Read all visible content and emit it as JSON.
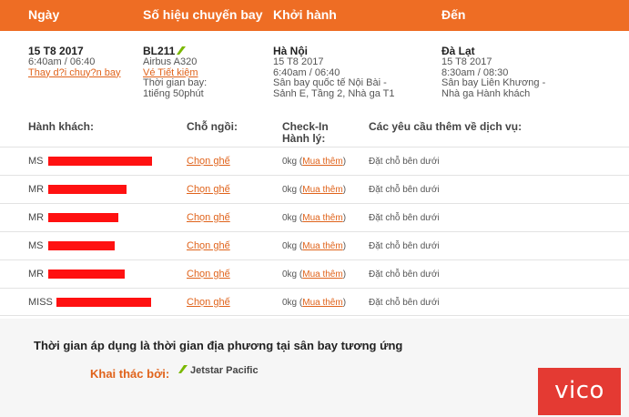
{
  "colors": {
    "accent": "#ee6d24",
    "link": "#e0631b",
    "redaction": "#ff1111",
    "brand": "#e43a33",
    "operator_mark": "#7ab800"
  },
  "header": {
    "date": "Ngày",
    "flight_no": "Số hiệu chuyến bay",
    "departure": "Khởi hành",
    "arrival": "Đến"
  },
  "flight": {
    "date": "15 T8 2017",
    "time": "6:40am / 06:40",
    "change_link": "Thay d?i chuy?n bay",
    "number": "BL211",
    "aircraft": "Airbus A320",
    "fare_link": "Vé Tiết kiệm",
    "duration_label": "Thời gian bay:",
    "duration": "1tiếng 50phút",
    "origin": {
      "city": "Hà Nội",
      "date": "15 T8 2017",
      "time": "6:40am / 06:40",
      "airport": "Sân bay quốc tế Nội Bài -",
      "terminal": "Sảnh E, Tầng 2, Nhà ga T1"
    },
    "destination": {
      "city": "Đà Lạt",
      "date": "15 T8 2017",
      "time": "8:30am / 08:30",
      "airport": "Sân bay Liên Khương -",
      "terminal": "Nhà ga Hành khách"
    }
  },
  "passengers_header": {
    "passenger": "Hành khách:",
    "seat": "Chỗ ngồi:",
    "checkin_line1": "Check-In",
    "checkin_line2": "Hành lý:",
    "extra": "Các yêu cầu thêm về dịch vụ:"
  },
  "passengers": [
    {
      "title": "MS",
      "seat": "Chọn ghế",
      "bag": "0kg (",
      "buy": "Mua thêm",
      "bag_end": ")",
      "service": "Đặt chỗ bên dưới"
    },
    {
      "title": "MR",
      "seat": "Chọn ghế",
      "bag": "0kg (",
      "buy": "Mua thêm",
      "bag_end": ")",
      "service": "Đặt chỗ bên dưới"
    },
    {
      "title": "MR",
      "seat": "Chọn ghế",
      "bag": "0kg (",
      "buy": "Mua thêm",
      "bag_end": ")",
      "service": "Đặt chỗ bên dưới"
    },
    {
      "title": "MS",
      "seat": "Chọn ghế",
      "bag": "0kg (",
      "buy": "Mua thêm",
      "bag_end": ")",
      "service": "Đặt chỗ bên dưới"
    },
    {
      "title": "MR",
      "seat": "Chọn ghế",
      "bag": "0kg (",
      "buy": "Mua thêm",
      "bag_end": ")",
      "service": "Đặt chỗ bên dưới"
    },
    {
      "title": "MISS",
      "seat": "Chọn ghế",
      "bag": "0kg (",
      "buy": "Mua thêm",
      "bag_end": ")",
      "service": "Đặt chỗ bên dưới"
    }
  ],
  "footer": {
    "note": "Thời gian áp dụng là thời gian địa phương tại sân bay tương ứng",
    "operator_label": "Khai thác bởi:",
    "operator_name": "Jetstar Pacific"
  },
  "brand": {
    "logo": "vico",
    "icon": "vico-logo"
  }
}
